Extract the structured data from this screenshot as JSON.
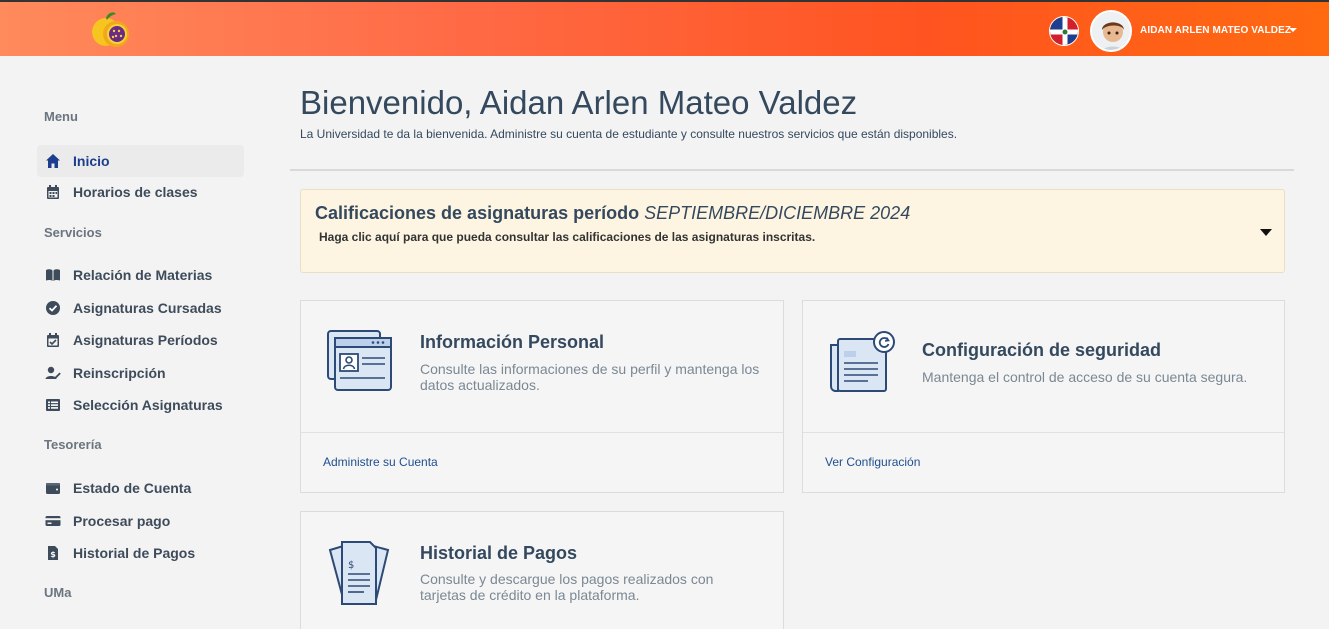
{
  "header": {
    "user_name": "AIDAN ARLEN MATEO VALDEZ",
    "accent": "#ff5a1f"
  },
  "sidebar": {
    "sections": [
      {
        "title": "Menu"
      },
      {
        "title": "Servicios"
      },
      {
        "title": "Tesorería"
      },
      {
        "title": "UMa"
      }
    ],
    "items": [
      {
        "label": "Inicio",
        "icon": "home-icon"
      },
      {
        "label": "Horarios de clases",
        "icon": "calendar-icon"
      },
      {
        "label": "Relación de Materias",
        "icon": "book-open-icon"
      },
      {
        "label": "Asignaturas Cursadas",
        "icon": "check-circle-icon"
      },
      {
        "label": "Asignaturas Períodos",
        "icon": "calendar-check-icon"
      },
      {
        "label": "Reinscripción",
        "icon": "user-edit-icon"
      },
      {
        "label": "Selección Asignaturas",
        "icon": "list-icon"
      },
      {
        "label": "Estado de Cuenta",
        "icon": "wallet-icon"
      },
      {
        "label": "Procesar pago",
        "icon": "credit-card-icon"
      },
      {
        "label": "Historial de Pagos",
        "icon": "file-invoice-dollar-icon"
      }
    ]
  },
  "main": {
    "welcome_title": "Bienvenido, Aidan Arlen Mateo Valdez",
    "welcome_subtitle": "La Universidad te da la bienvenida. Administre su cuenta de estudiante y consulte nuestros servicios que están disponibles.",
    "alert": {
      "title_prefix": "Calificaciones de asignaturas período",
      "title_period": "SEPTIEMBRE/DICIEMBRE 2024",
      "subtitle": "Haga clic aquí para que pueda consultar las calificaciones de las asignaturas inscritas."
    },
    "cards": [
      {
        "title": "Información Personal",
        "description": "Consulte las informaciones de su perfil y mantenga los datos actualizados.",
        "link": "Administre su Cuenta"
      },
      {
        "title": "Configuración de seguridad",
        "description": "Mantenga el control de acceso de su cuenta segura.",
        "link": "Ver Configuración"
      },
      {
        "title": "Historial de Pagos",
        "description": "Consulte y descargue los pagos realizados con tarjetas de crédito en la plataforma."
      }
    ]
  }
}
